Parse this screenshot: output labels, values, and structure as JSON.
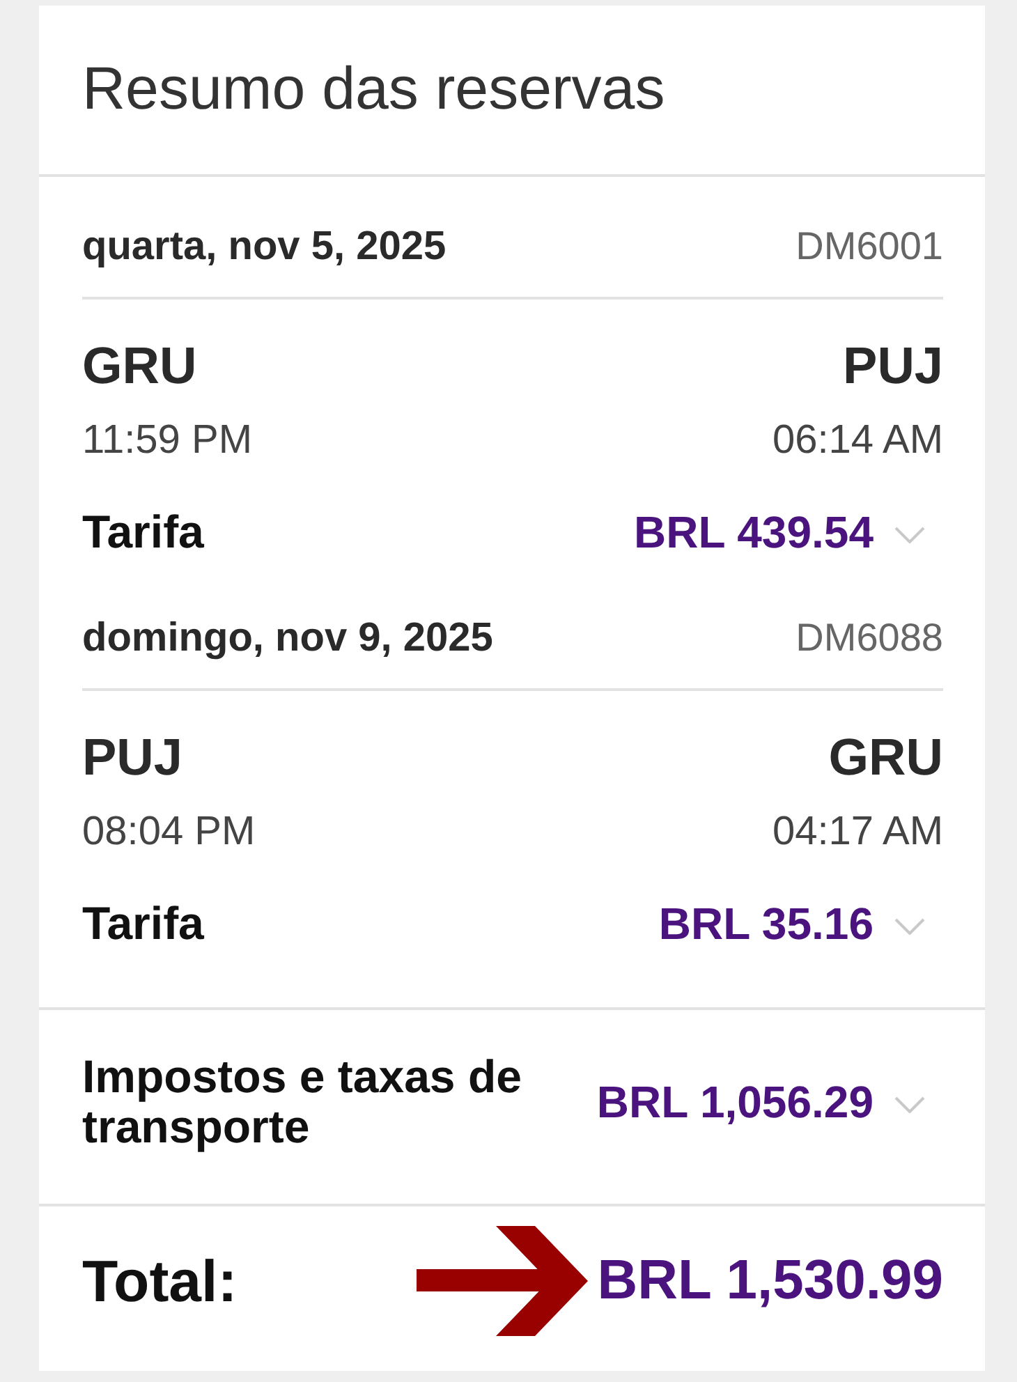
{
  "summary": {
    "title": "Resumo das reservas"
  },
  "segments": [
    {
      "date": "quarta, nov 5, 2025",
      "flight": "DM6001",
      "origin": {
        "code": "GRU",
        "time": "11:59 PM"
      },
      "destination": {
        "code": "PUJ",
        "time": "06:14 AM"
      },
      "fare": {
        "label": "Tarifa",
        "amount": "BRL 439.54",
        "expanded": false
      }
    },
    {
      "date": "domingo, nov 9, 2025",
      "flight": "DM6088",
      "origin": {
        "code": "PUJ",
        "time": "08:04 PM"
      },
      "destination": {
        "code": "GRU",
        "time": "04:17 AM"
      },
      "fare": {
        "label": "Tarifa",
        "amount": "BRL 35.16",
        "expanded": false
      }
    }
  ],
  "taxes": {
    "label": "Impostos e taxas de transporte",
    "amount": "BRL 1,056.29",
    "expanded": false
  },
  "total": {
    "label": "Total:",
    "amount": "BRL 1,530.99"
  }
}
